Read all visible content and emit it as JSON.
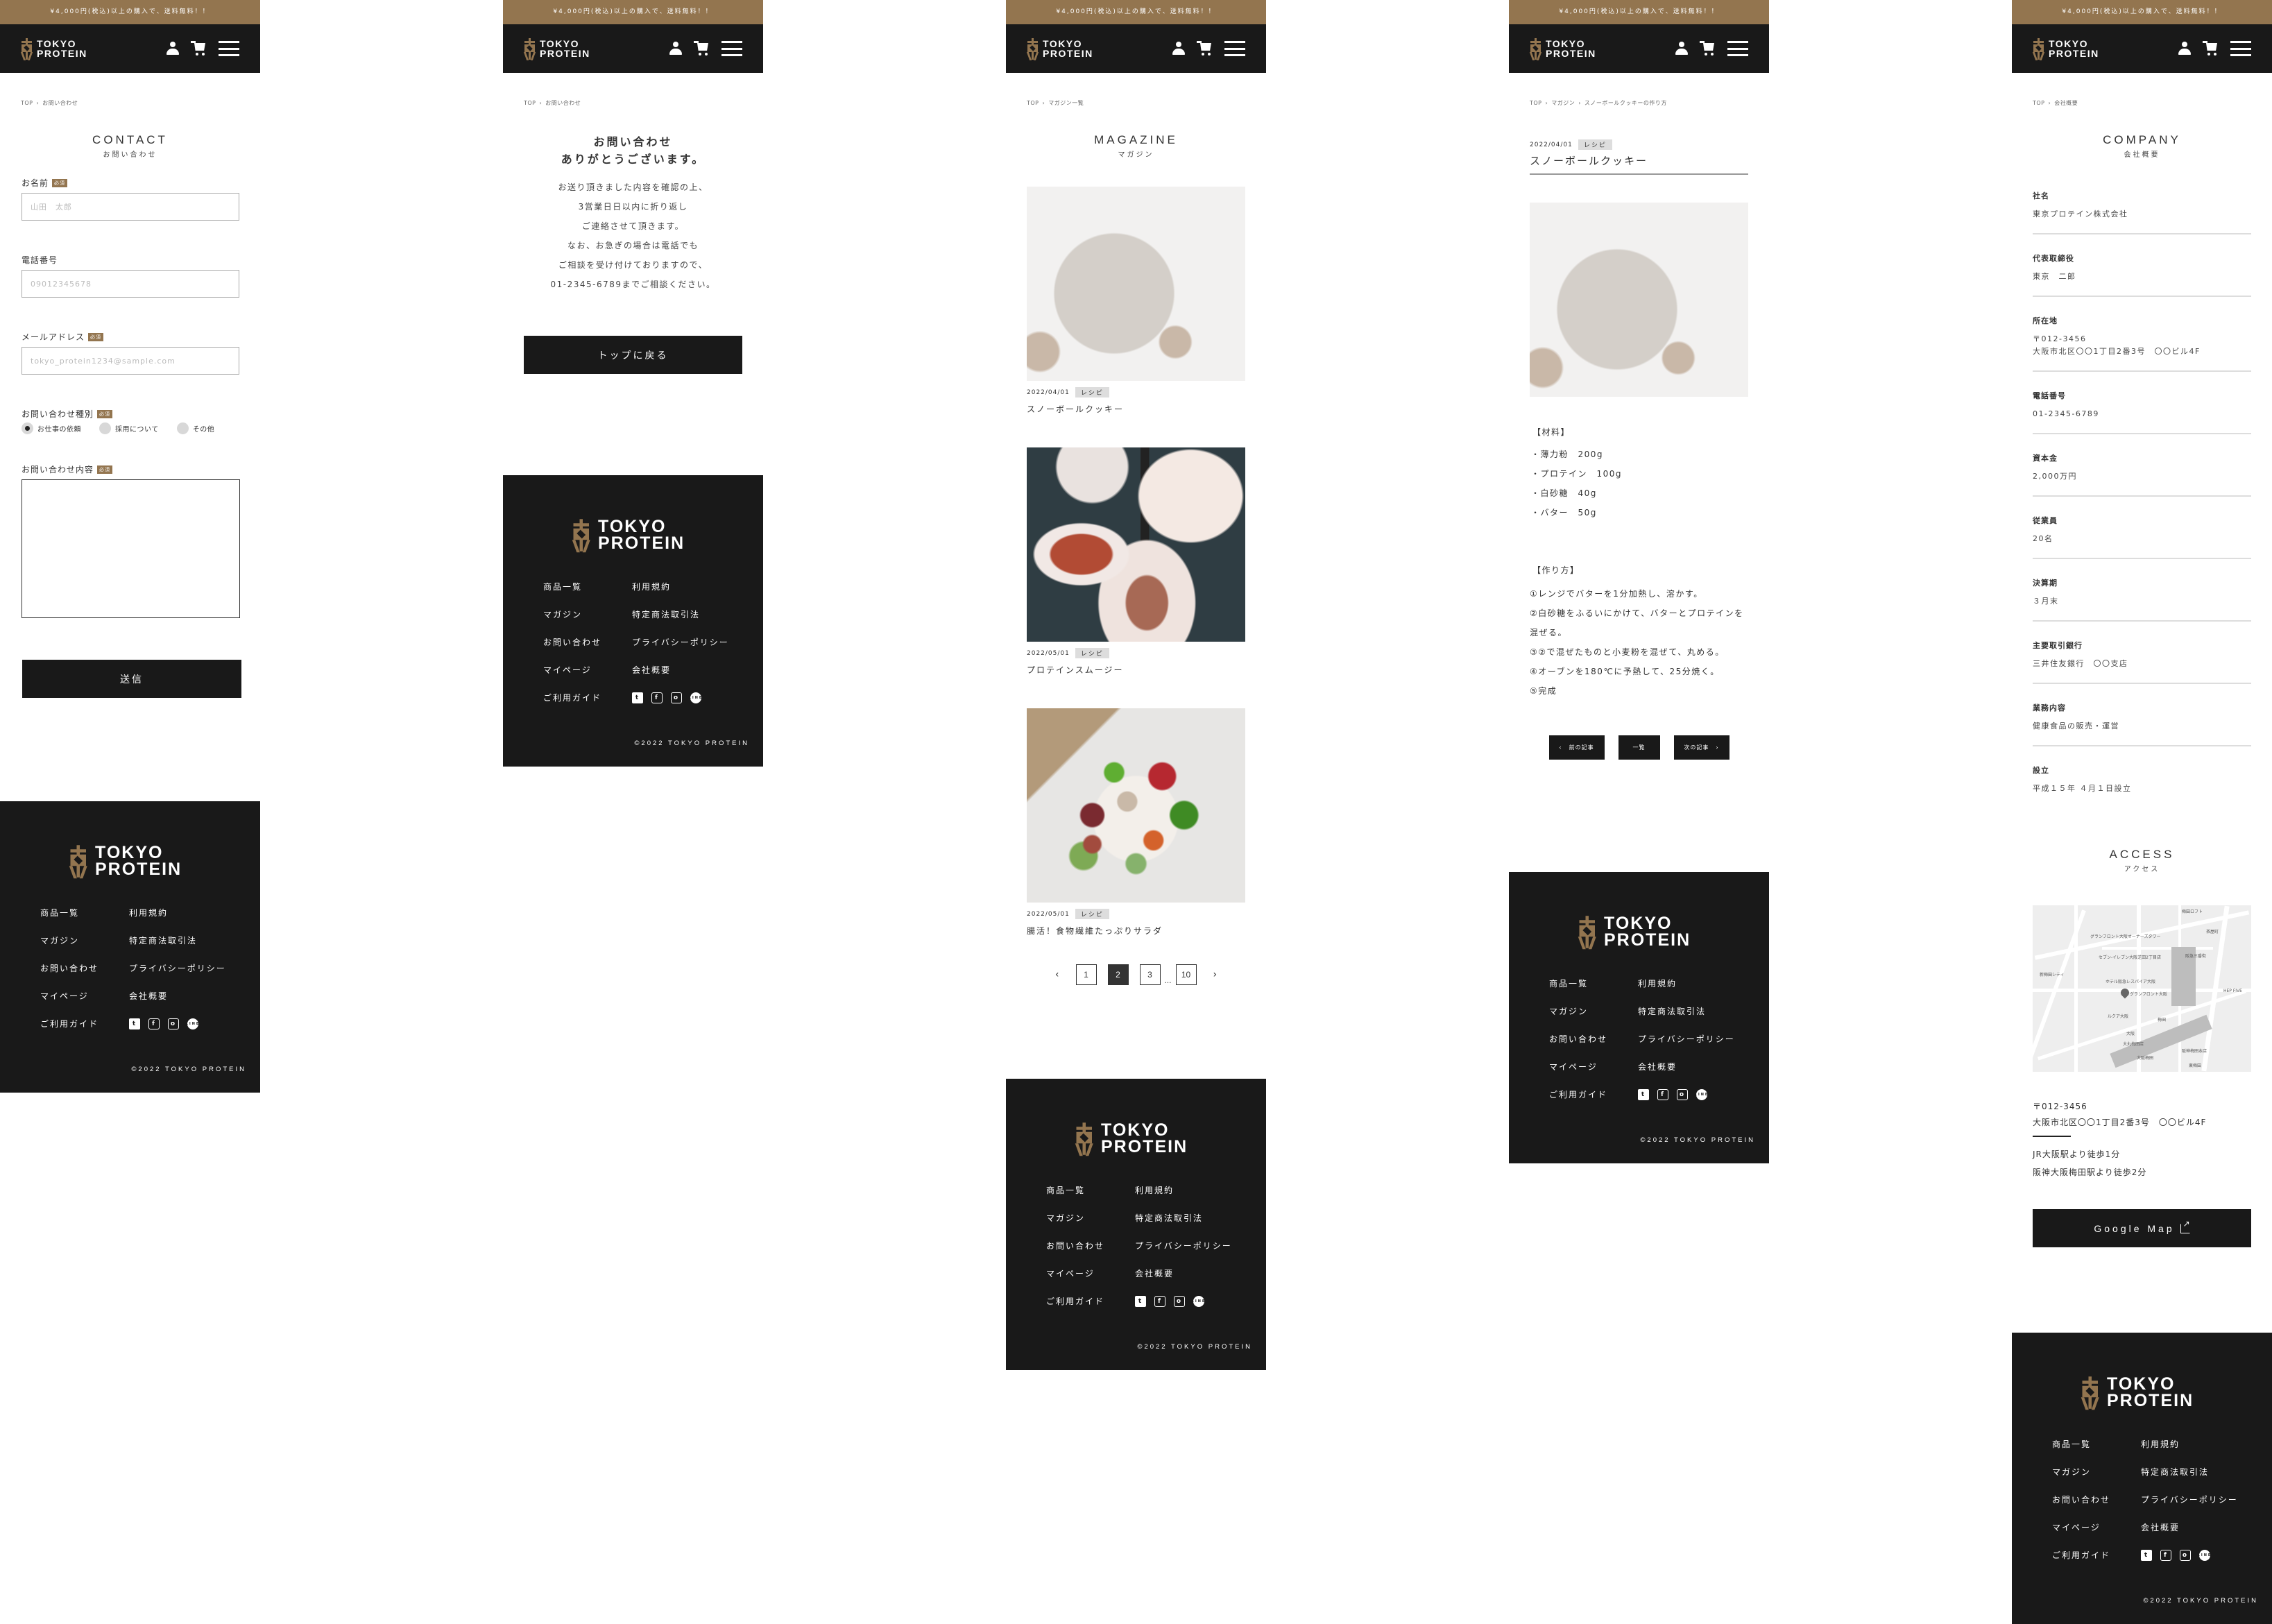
{
  "common": {
    "promo": "¥4,000円(税込)以上の購入で、送料無料！！",
    "logo_line1": "TOKYO",
    "logo_line2": "PROTEIN",
    "crumb_top": "TOP",
    "crumb_sep": "›",
    "footer": {
      "col1": [
        "商品一覧",
        "マガジン",
        "お問い合わせ",
        "マイページ",
        "ご利用ガイド"
      ],
      "col2": [
        "利用規約",
        "特定商法取引法",
        "プライバシーポリシー",
        "会社概要"
      ],
      "social": {
        "twitter": "t",
        "facebook": "f",
        "instagram": "o",
        "line": "LINE"
      },
      "copyright": "©2022 TOKYO PROTEIN"
    },
    "colors": {
      "brand": "#93754f",
      "dark": "#191919"
    }
  },
  "contact": {
    "crumb": "お問い合わせ",
    "title_en": "CONTACT",
    "title_ja": "お問い合わせ",
    "required": "必須",
    "name_label": "お名前",
    "name_placeholder": "山田　太郎",
    "phone_label": "電話番号",
    "phone_placeholder": "09012345678",
    "email_label": "メールアドレス",
    "email_placeholder": "tokyo_protein1234@sample.com",
    "type_label": "お問い合わせ種別",
    "type_options": [
      "お仕事の依頼",
      "採用について",
      "その他"
    ],
    "type_selected": "お仕事の依頼",
    "message_label": "お問い合わせ内容",
    "message_value": "",
    "submit": "送信"
  },
  "thanks": {
    "crumb": "お問い合わせ",
    "title_line1": "お問い合わせ",
    "title_line2": "ありがとうございます。",
    "body": [
      "お送り頂きました内容を確認の上、",
      "3営業日日以内に折り返し",
      "ご連絡させて頂きます。",
      "なお、お急ぎの場合は電話でも",
      "ご相談を受け付けておりますので、",
      "01-2345-6789までご相談ください。"
    ],
    "back_button": "トップに戻る"
  },
  "magazine": {
    "crumb": "マガジン一覧",
    "title_en": "MAGAZINE",
    "title_ja": "マガジン",
    "articles": [
      {
        "date": "2022/04/01",
        "tag": "レシピ",
        "title": "スノーボールクッキー",
        "image": "snowball-cookies-photo"
      },
      {
        "date": "2022/05/01",
        "tag": "レシピ",
        "title": "プロテインスムージー",
        "image": "protein-smoothie-photo"
      },
      {
        "date": "2022/05/01",
        "tag": "レシピ",
        "title": "腸活！食物繊維たっぷりサラダ",
        "image": "salad-bowl-photo"
      }
    ],
    "pagination": {
      "prev": "‹",
      "pages": [
        "1",
        "2",
        "3"
      ],
      "ellipsis": "…",
      "last": "10",
      "next": "›",
      "current": "2"
    }
  },
  "article": {
    "crumb": [
      "マガジン",
      "スノーボールクッキーの作り方"
    ],
    "date": "2022/04/01",
    "tag": "レシピ",
    "title": "スノーボールクッキー",
    "ingredients_heading": "【材料】",
    "ingredients": [
      "・薄力粉　200g",
      "・プロテイン　100g",
      "・白砂糖　40g",
      "・バター　50g"
    ],
    "steps_heading": "【作り方】",
    "steps": [
      "①レンジでバターを1分加熱し、溶かす。",
      "②白砂糖をふるいにかけて、バターとプロテインを混ぜる。",
      "③②で混ぜたものと小麦粉を混ぜて、丸める。",
      "④オーブンを180℃に予熱して、25分焼く。",
      "⑤完成"
    ],
    "prev": "前の記事",
    "list": "一覧",
    "next": "次の記事"
  },
  "company": {
    "crumb": "会社概要",
    "title_en": "COMPANY",
    "title_ja": "会社概要",
    "items": [
      {
        "label": "社名",
        "value": "東京プロテイン株式会社"
      },
      {
        "label": "代表取締役",
        "value": "東京　二郎"
      },
      {
        "label": "所在地",
        "value": "〒012-3456\n大阪市北区〇〇1丁目2番3号　〇〇ビル4F"
      },
      {
        "label": "電話番号",
        "value": "01-2345-6789"
      },
      {
        "label": "資本金",
        "value": "2,000万円"
      },
      {
        "label": "従業員",
        "value": "20名"
      },
      {
        "label": "決算期",
        "value": "３月末"
      },
      {
        "label": "主要取引銀行",
        "value": "三井住友銀行　〇〇支店"
      },
      {
        "label": "業務内容",
        "value": "健康食品の販売・運営"
      },
      {
        "label": "設立",
        "value": "平成１５年 ４月１日設立"
      }
    ],
    "access_en": "ACCESS",
    "access_ja": "アクセス",
    "map_labels": [
      "グランフロント大阪オーナーズタワー",
      "セブン-イレブン大阪芝田2丁目店",
      "ホテル阪急レスパイア大阪",
      "グランフロント大阪",
      "ルクア大阪",
      "大阪",
      "大丸梅田店",
      "大阪梅田",
      "阪神梅田本店",
      "梅田",
      "阪急三番街",
      "茶屋町",
      "HEP FIVE",
      "新梅田シティ",
      "梅田ロフト",
      "東梅田"
    ],
    "postal": "〒012-3456",
    "address": "大阪市北区〇〇1丁目2番3号　〇〇ビル4F",
    "routes": [
      "JR大阪駅より徒歩1分",
      "阪神大阪梅田駅より徒歩2分"
    ],
    "map_button": "Google Map"
  }
}
